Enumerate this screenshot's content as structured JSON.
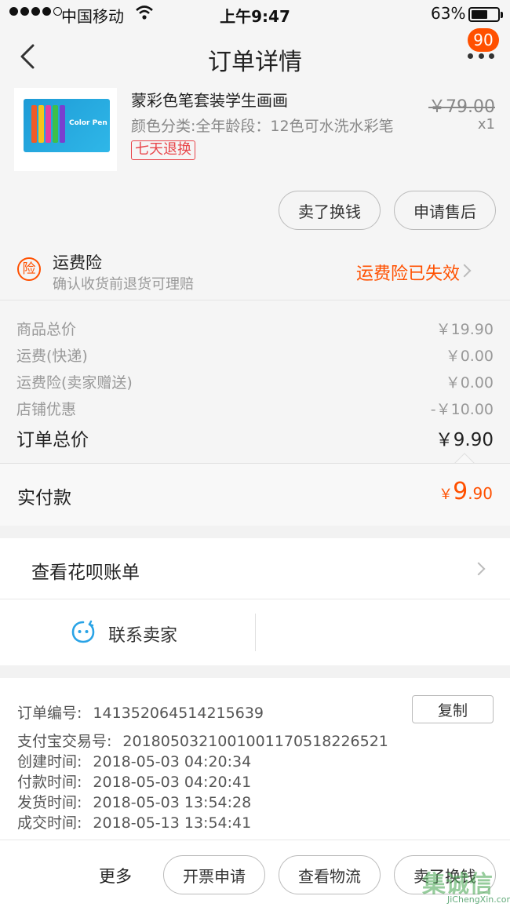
{
  "status_bar": {
    "carrier": "中国移动",
    "time": "上午9:47",
    "battery": "63%",
    "battery_level": 0.63
  },
  "nav": {
    "title": "订单详情",
    "badge": "90"
  },
  "product": {
    "name": "蒙彩色笔套装学生画画",
    "spec": "颜色分类:全年龄段：12色可水洗水彩笔",
    "tag": "七天退换",
    "original_price": "￥79.00",
    "quantity": "x1",
    "thumb_text": "Color Pen",
    "actions": [
      "卖了换钱",
      "申请售后"
    ]
  },
  "insurance": {
    "title": "运费险",
    "subtitle": "确认收货前退货可理赔",
    "status": "运费险已失效"
  },
  "prices": {
    "rows": [
      {
        "label": "商品总价",
        "value": "￥19.90"
      },
      {
        "label": "运费(快递)",
        "value": "￥0.00"
      },
      {
        "label": "运费险(卖家赠送)",
        "value": "￥0.00"
      },
      {
        "label": "店铺优惠",
        "value": "-￥10.00"
      }
    ],
    "total_label": "订单总价",
    "total_value": "￥9.90"
  },
  "paid": {
    "label": "实付款",
    "currency": "￥",
    "integer": "9",
    "decimal": ".90"
  },
  "huabei": {
    "label": "查看花呗账单"
  },
  "contact": {
    "label": "联系卖家"
  },
  "order_info": {
    "order_no_label": "订单编号:",
    "order_no": "141352064514215639",
    "copy_label": "复制",
    "rows": [
      {
        "label": "支付宝交易号:",
        "value": "2018050321001001170518226521"
      },
      {
        "label": "创建时间:",
        "value": "2018-05-03 04:20:34"
      },
      {
        "label": "付款时间:",
        "value": "2018-05-03 04:20:41"
      },
      {
        "label": "发货时间:",
        "value": "2018-05-03 13:54:28"
      },
      {
        "label": "成交时间:",
        "value": "2018-05-13 13:54:41"
      }
    ]
  },
  "bottom_bar": {
    "more_label": "更多",
    "actions": [
      "开票申请",
      "查看物流",
      "卖了换钱"
    ]
  },
  "watermark": {
    "text": "集诚信",
    "url": "JiChengXin.com"
  },
  "colors": {
    "accent": "#ff5000",
    "tag": "#e8454a",
    "muted": "#999999"
  }
}
